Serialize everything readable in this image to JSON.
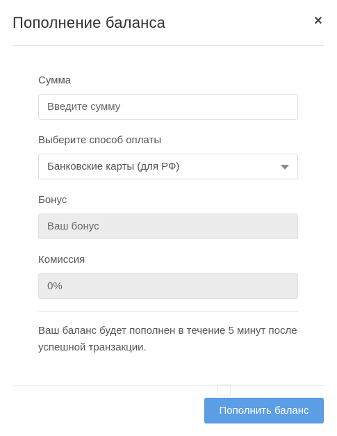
{
  "modal": {
    "title": "Пополнение баланса",
    "close_symbol": "×"
  },
  "form": {
    "amount": {
      "label": "Сумма",
      "placeholder": "Введите сумму",
      "value": ""
    },
    "payment_method": {
      "label": "Выберите способ оплаты",
      "selected": "Банковские карты (для РФ)"
    },
    "bonus": {
      "label": "Бонус",
      "value": "Ваш бонус"
    },
    "commission": {
      "label": "Комиссия",
      "value": "0%"
    },
    "info": "Ваш баланс будет пополнен в течение 5 минут после успешной транзакции."
  },
  "footer": {
    "submit_label": "Пополнить баланс"
  },
  "colors": {
    "accent": "#5b9ee6",
    "readonly_bg": "#ececec",
    "border": "#dcdcdc"
  },
  "icons": {
    "close": "close-icon",
    "select_caret": "chevron-down-icon"
  }
}
